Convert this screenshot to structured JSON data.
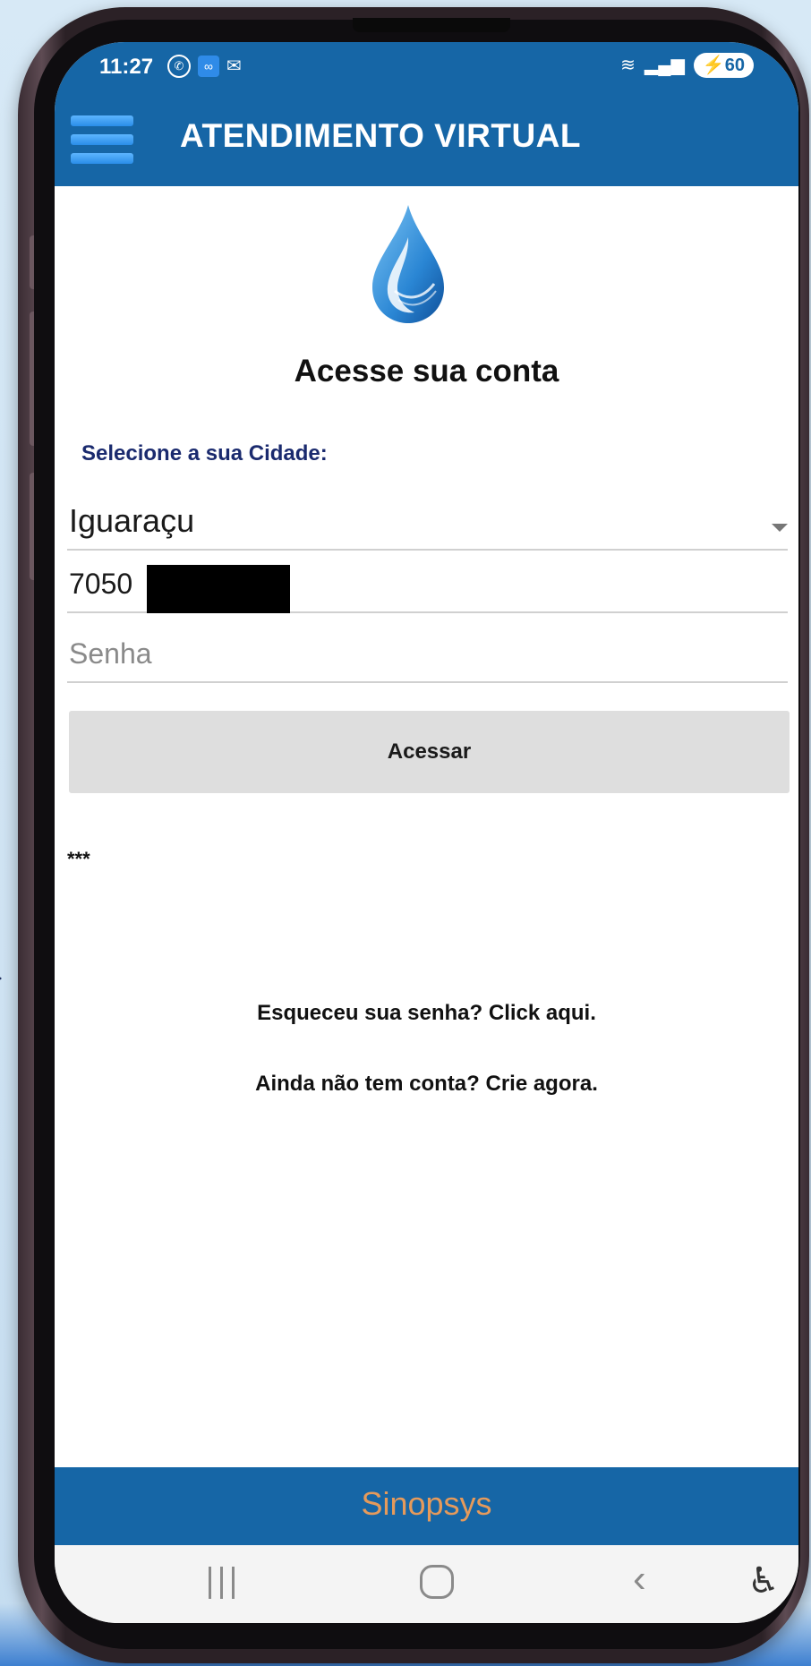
{
  "status_bar": {
    "time": "11:27",
    "battery": "60"
  },
  "app_bar": {
    "title": "ATENDIMENTO VIRTUAL"
  },
  "login": {
    "heading": "Acesse sua conta",
    "city_label": "Selecione a sua Cidade:",
    "city_value": "Iguaraçu",
    "account_value": "7050",
    "password_placeholder": "Senha",
    "submit_label": "Acessar",
    "message": "***"
  },
  "links": {
    "forgot_password": "Esqueceu sua senha? Click aqui.",
    "create_account": "Ainda não tem conta? Crie agora."
  },
  "footer": {
    "brand": "Sinopsys"
  },
  "colors": {
    "primary": "#1666a6",
    "footer_text": "#e59a5b",
    "label": "#1a2a6e",
    "button_bg": "#dedede"
  },
  "icons": {
    "menu": "hamburger-icon",
    "logo": "water-drop-icon",
    "dropdown": "caret-down-icon",
    "nav_recents": "recents-icon",
    "nav_home": "home-icon",
    "nav_back": "back-icon",
    "accessibility": "accessibility-icon"
  }
}
